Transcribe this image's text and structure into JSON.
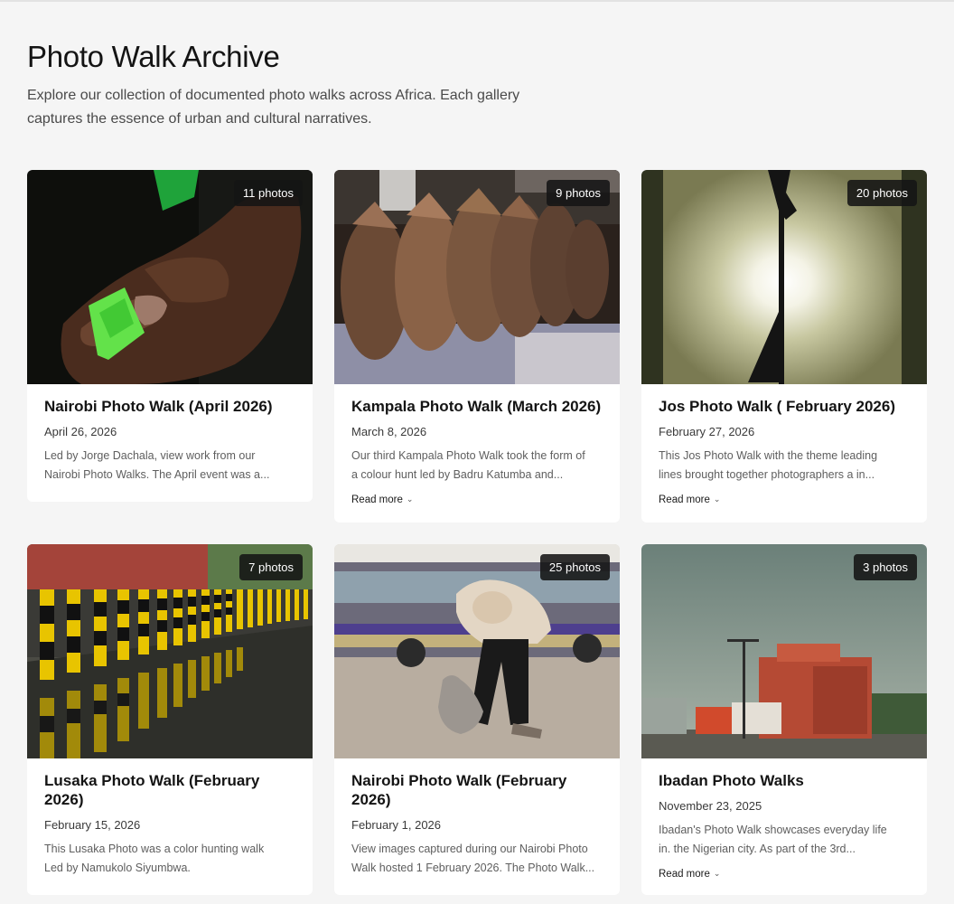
{
  "page": {
    "title": "Photo Walk Archive",
    "intro_line1": "Explore our collection of documented photo walks across Africa. Each gallery",
    "intro_line2": "captures the essence of urban and cultural narratives."
  },
  "read_more_label": "Read more",
  "cards": [
    {
      "title": "Nairobi Photo Walk (April 2026)",
      "date": "April 26, 2026",
      "excerpt_line1": "Led by Jorge Dachala, view work from our",
      "excerpt_line2": "Nairobi Photo Walks. The April event was a...",
      "photos": "11 photos",
      "has_read_more": false
    },
    {
      "title": "Kampala Photo Walk (March 2026)",
      "date": "March 8, 2026",
      "excerpt_line1": "Our third Kampala Photo Walk took the form of",
      "excerpt_line2": "a colour hunt led by Badru Katumba and...",
      "photos": "9 photos",
      "has_read_more": true
    },
    {
      "title": "Jos Photo Walk ( February 2026)",
      "date": "February 27, 2026",
      "excerpt_line1": "This Jos Photo Walk with the theme leading",
      "excerpt_line2": "lines brought together photographers a in...",
      "photos": "20 photos",
      "has_read_more": true
    },
    {
      "title_line1": "Lusaka Photo Walk (February",
      "title_line2": "2026)",
      "date": "February 15, 2026",
      "excerpt_line1": "This Lusaka Photo was a color hunting walk",
      "excerpt_line2": "Led by Namukolo Siyumbwa.",
      "photos": "7 photos",
      "has_read_more": false
    },
    {
      "title_line1": "Nairobi Photo Walk (February",
      "title_line2": "2026)",
      "date": "February 1, 2026",
      "excerpt_line1": "View images captured during our Nairobi Photo",
      "excerpt_line2": "Walk hosted 1 February 2026. The Photo Walk...",
      "photos": "25 photos",
      "has_read_more": false
    },
    {
      "title": "Ibadan Photo Walks",
      "date": "November 23, 2025",
      "excerpt_line1": "Ibadan's Photo Walk showcases everyday life",
      "excerpt_line2": "in. the Nigerian city. As part of the 3rd...",
      "photos": "3 photos",
      "has_read_more": true
    }
  ]
}
